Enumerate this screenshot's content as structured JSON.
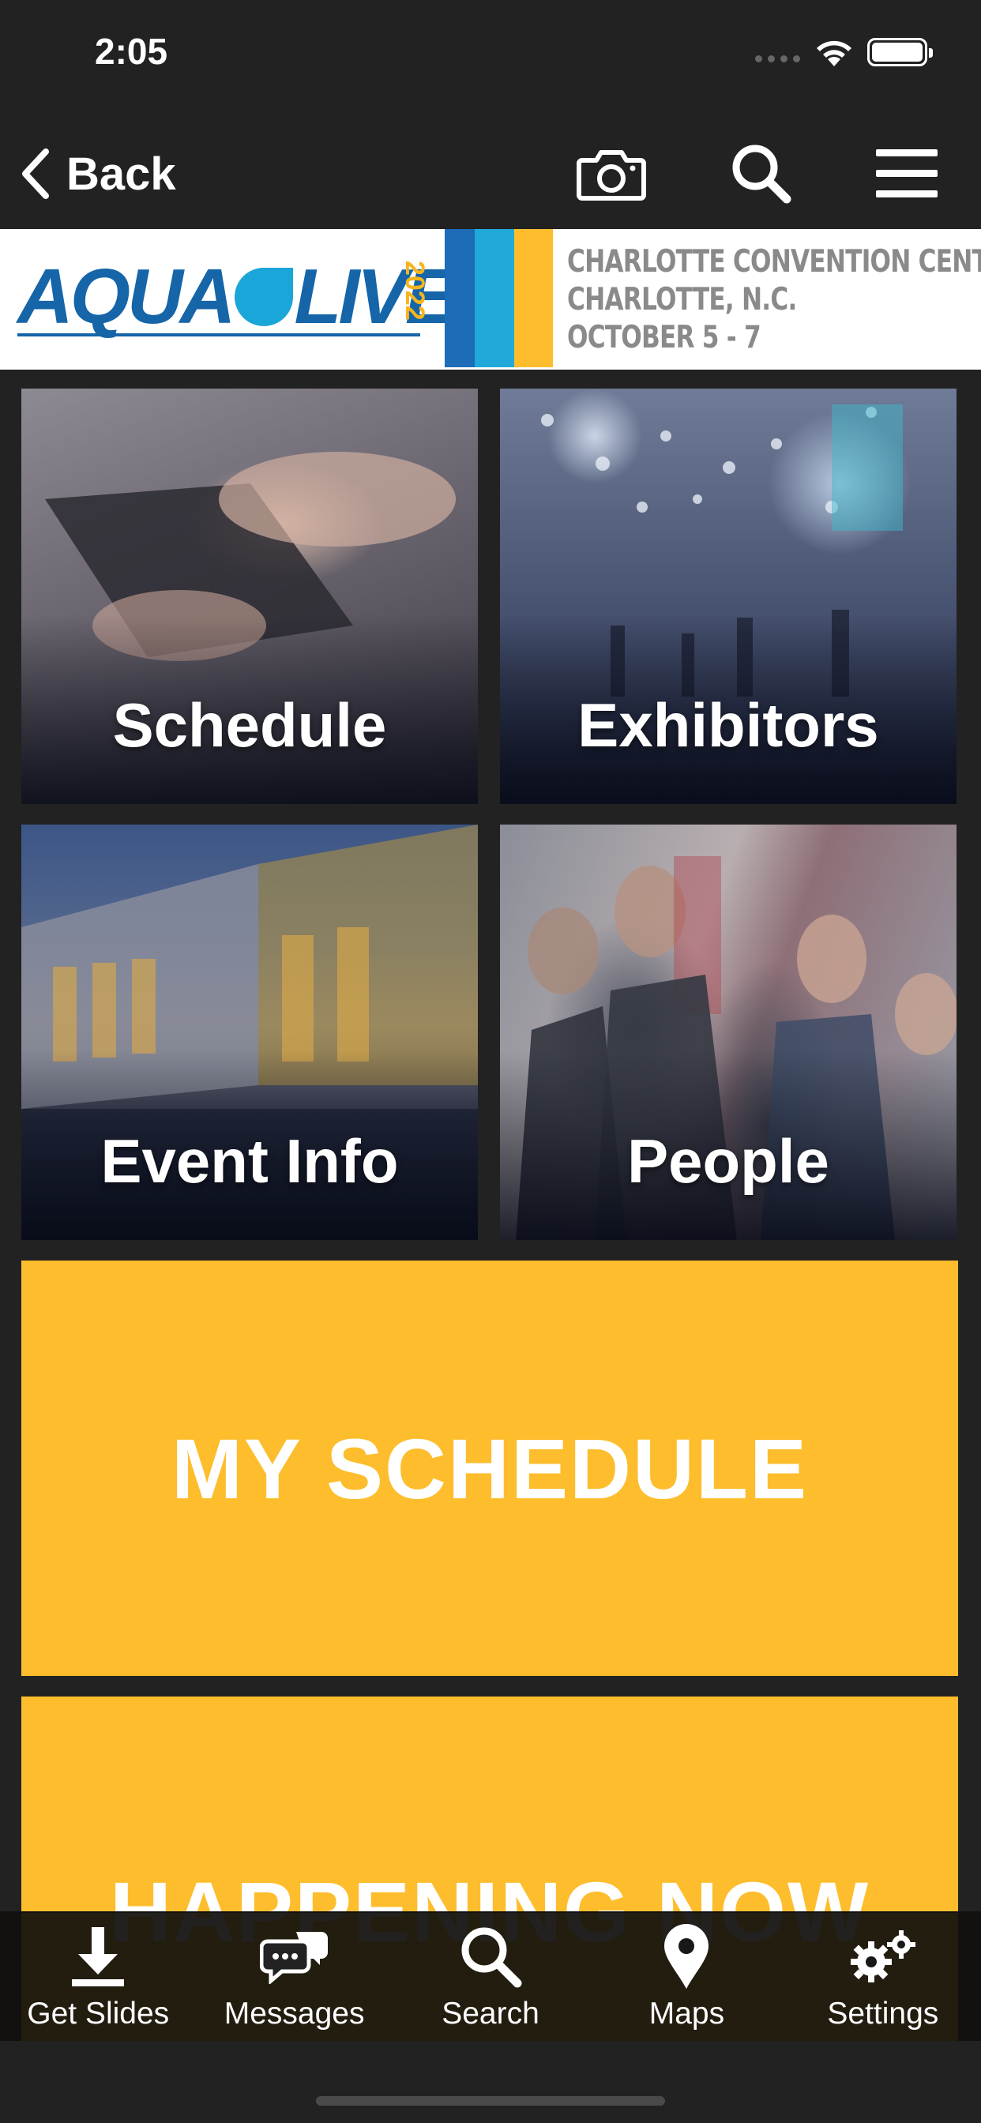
{
  "status_bar": {
    "time": "2:05"
  },
  "navbar": {
    "back_label": "Back"
  },
  "banner": {
    "logo_left": "AQUA",
    "logo_right": "LIVE",
    "logo_year": "2022",
    "venue_lines": [
      "CHARLOTTE CONVENTION CENTER",
      "CHARLOTTE, N.C.",
      "OCTOBER 5 - 7"
    ],
    "colors": {
      "brand_blue": "#1565a8",
      "brand_yellow": "#fdbd2c",
      "stripe_blue": "#1c6cb7",
      "stripe_cyan": "#21a9d9"
    }
  },
  "tiles": [
    {
      "label": "Schedule"
    },
    {
      "label": "Exhibitors"
    },
    {
      "label": "Event Info"
    },
    {
      "label": "People"
    }
  ],
  "my_schedule": {
    "label": "MY SCHEDULE"
  },
  "happening_now": {
    "label": "HAPPENING NOW"
  },
  "tab_bar": {
    "items": [
      {
        "label": "Get Slides",
        "icon": "download-icon"
      },
      {
        "label": "Messages",
        "icon": "chat-bubbles-icon"
      },
      {
        "label": "Search",
        "icon": "search-icon"
      },
      {
        "label": "Maps",
        "icon": "map-pin-icon"
      },
      {
        "label": "Settings",
        "icon": "gears-icon"
      }
    ]
  }
}
